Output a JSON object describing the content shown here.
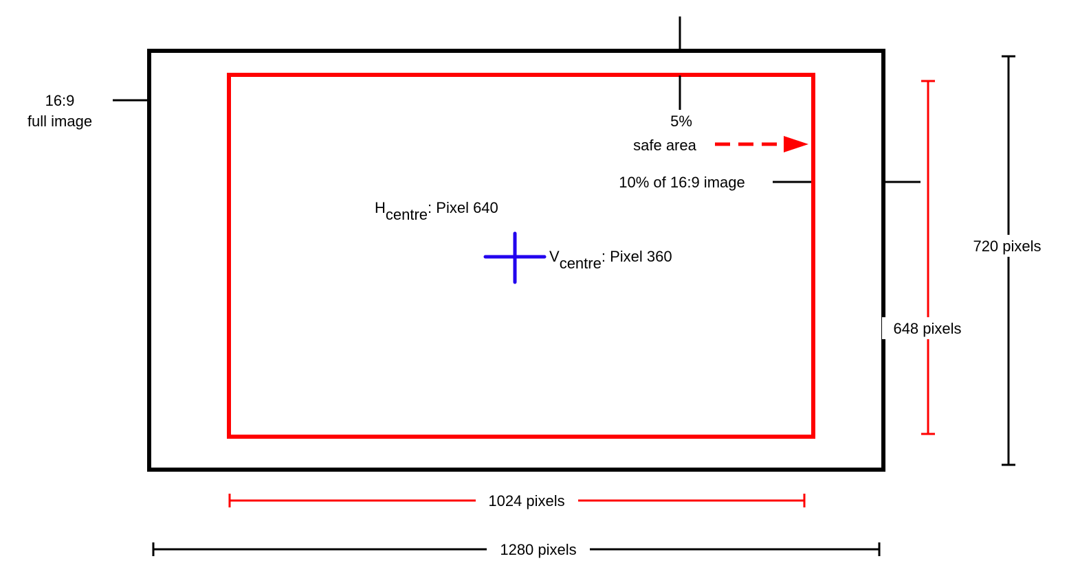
{
  "labels": {
    "full_image_line1": "16:9",
    "full_image_line2": "full image",
    "safe_area_line1": "5%",
    "safe_area_line2": "safe area",
    "ten_percent": "10% of 16:9 image",
    "h_centre_main": "H",
    "h_centre_sub": "centre",
    "h_centre_value": ": Pixel 640",
    "v_centre_main": "V",
    "v_centre_sub": "centre",
    "v_centre_value": ": Pixel 360",
    "height_full": "720 pixels",
    "height_safe": "648 pixels",
    "width_safe": "1024 pixels",
    "width_full": "1280 pixels"
  },
  "colors": {
    "full_image_frame": "#000000",
    "safe_area_frame": "#ff0000",
    "centre_cross": "#2200ee",
    "background": "#ffffff"
  }
}
